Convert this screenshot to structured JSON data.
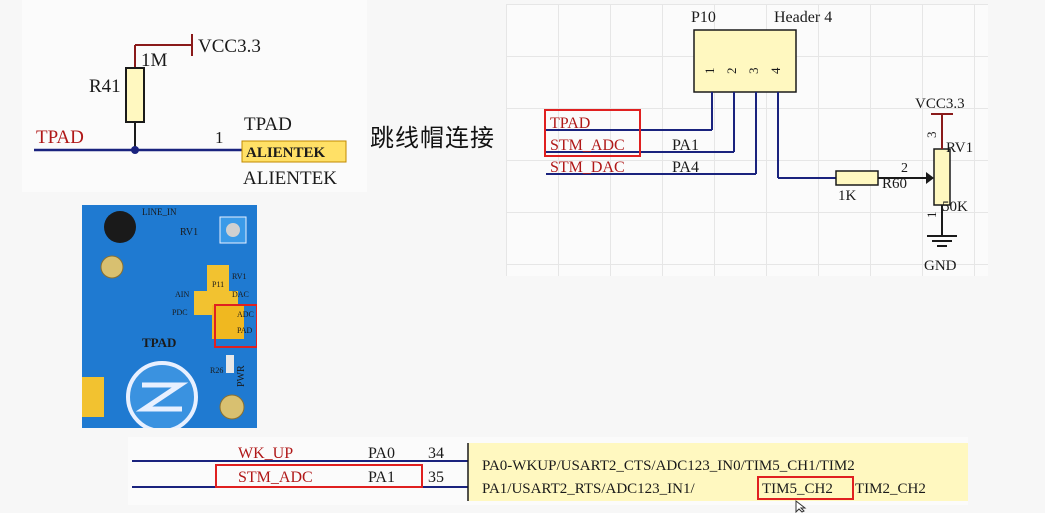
{
  "caption": "跳线帽连接",
  "left_schematic": {
    "power_label": "VCC3.3",
    "resistor_ref": "R41",
    "resistor_value": "1M",
    "net_label": "TPAD",
    "pin_number": "1",
    "connector_name": "TPAD",
    "connector_logo": "ALIENTEK",
    "connector_sub": "ALIENTEK"
  },
  "right_schematic": {
    "header_ref": "P10",
    "header_name": "Header 4",
    "header_pins": [
      "1",
      "2",
      "3",
      "4"
    ],
    "nets": [
      {
        "name": "TPAD",
        "pin": ""
      },
      {
        "name": "STM_ADC",
        "pin": "PA1"
      },
      {
        "name": "STM_DAC",
        "pin": "PA4"
      }
    ],
    "resistor_value": "1K",
    "resistor_ref": "R60",
    "pot_ref": "RV1",
    "pot_value": "50K",
    "pot_pins": [
      "3",
      "2",
      "1"
    ],
    "power_label": "VCC3.3",
    "ground_label": "GND"
  },
  "board_photo": {
    "labels": [
      "TPAD",
      "LINE_IN",
      "RV1",
      "P11",
      "AIN",
      "PDC",
      "DAC",
      "ADC",
      "PAD",
      "R26",
      "PWR"
    ]
  },
  "bottom_schematic": {
    "rows": [
      {
        "net": "WK_UP",
        "pin": "PA0",
        "number": "34",
        "function": "PA0-WKUP/USART2_CTS/ADC123_IN0/TIM5_CH1/TIM2",
        "highlight": ""
      },
      {
        "net": "STM_ADC",
        "pin": "PA1",
        "number": "35",
        "function": "PA1/USART2_RTS/ADC123_IN1/",
        "highlight": "TIM5_CH2",
        "tail": "TIM2_CH2"
      }
    ]
  },
  "colors": {
    "wire": "#1a237e",
    "highlight_box": "#e02020",
    "component_fill": "#fff8c0",
    "board": "#1f7ad1",
    "net_text": "#b01818"
  }
}
